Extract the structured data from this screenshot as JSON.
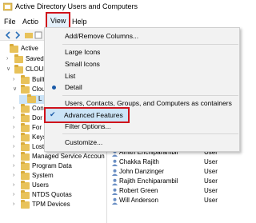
{
  "window": {
    "title": "Active Directory Users and Computers"
  },
  "menubar": {
    "file": "File",
    "action": "Actio",
    "view": "View",
    "help": "Help"
  },
  "view_menu": {
    "items": [
      {
        "label": "Add/Remove Columns..."
      },
      {
        "label": "Large Icons"
      },
      {
        "label": "Small Icons"
      },
      {
        "label": "List"
      },
      {
        "label": "Detail",
        "selected": true
      },
      {
        "label": "Users, Contacts, Groups, and Computers as containers"
      },
      {
        "label": "Advanced Features",
        "checked": true
      },
      {
        "label": "Filter Options..."
      },
      {
        "label": "Customize..."
      }
    ]
  },
  "tree": {
    "items": [
      {
        "label": "Active"
      },
      {
        "label": "Saved Q"
      },
      {
        "label": "CLOUDI"
      },
      {
        "label": "Built"
      },
      {
        "label": "Clou"
      },
      {
        "label": "L"
      },
      {
        "label": "Con"
      },
      {
        "label": "Dor"
      },
      {
        "label": "For"
      },
      {
        "label": "Keys"
      },
      {
        "label": "Lost"
      },
      {
        "label": "Managed Service Accoun"
      },
      {
        "label": "Program Data"
      },
      {
        "label": "System"
      },
      {
        "label": "Users"
      },
      {
        "label": "NTDS Quotas"
      },
      {
        "label": "TPM Devices"
      }
    ]
  },
  "details": {
    "rows": [
      {
        "name": "Amith Enchiparambil",
        "type": "User"
      },
      {
        "name": "Chakka Rajith",
        "type": "User"
      },
      {
        "name": "John Danzinger",
        "type": "User"
      },
      {
        "name": "Rajith Enchiparambil",
        "type": "User"
      },
      {
        "name": "Robert Green",
        "type": "User"
      },
      {
        "name": "Will Anderson",
        "type": "User"
      }
    ]
  },
  "colors": {
    "highlight_border": "#d0121b",
    "menu_bg": "#f2f2f2",
    "accent": "#1a5aa8"
  }
}
